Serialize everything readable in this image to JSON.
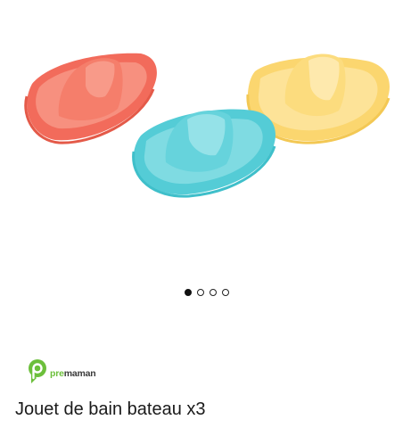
{
  "gallery": {
    "image_alt": "Jouet de bain bateau x3",
    "image_count": 4,
    "active_index": 0,
    "boat_colors": [
      "#f26b5b",
      "#54ccd6",
      "#fbd66f"
    ]
  },
  "brand": {
    "logo_icon": "premaman-logo-icon",
    "name_prefix": "pre",
    "name_suffix": "maman",
    "color": "#6cbf3b"
  },
  "product": {
    "title": "Jouet de bain bateau x3"
  }
}
